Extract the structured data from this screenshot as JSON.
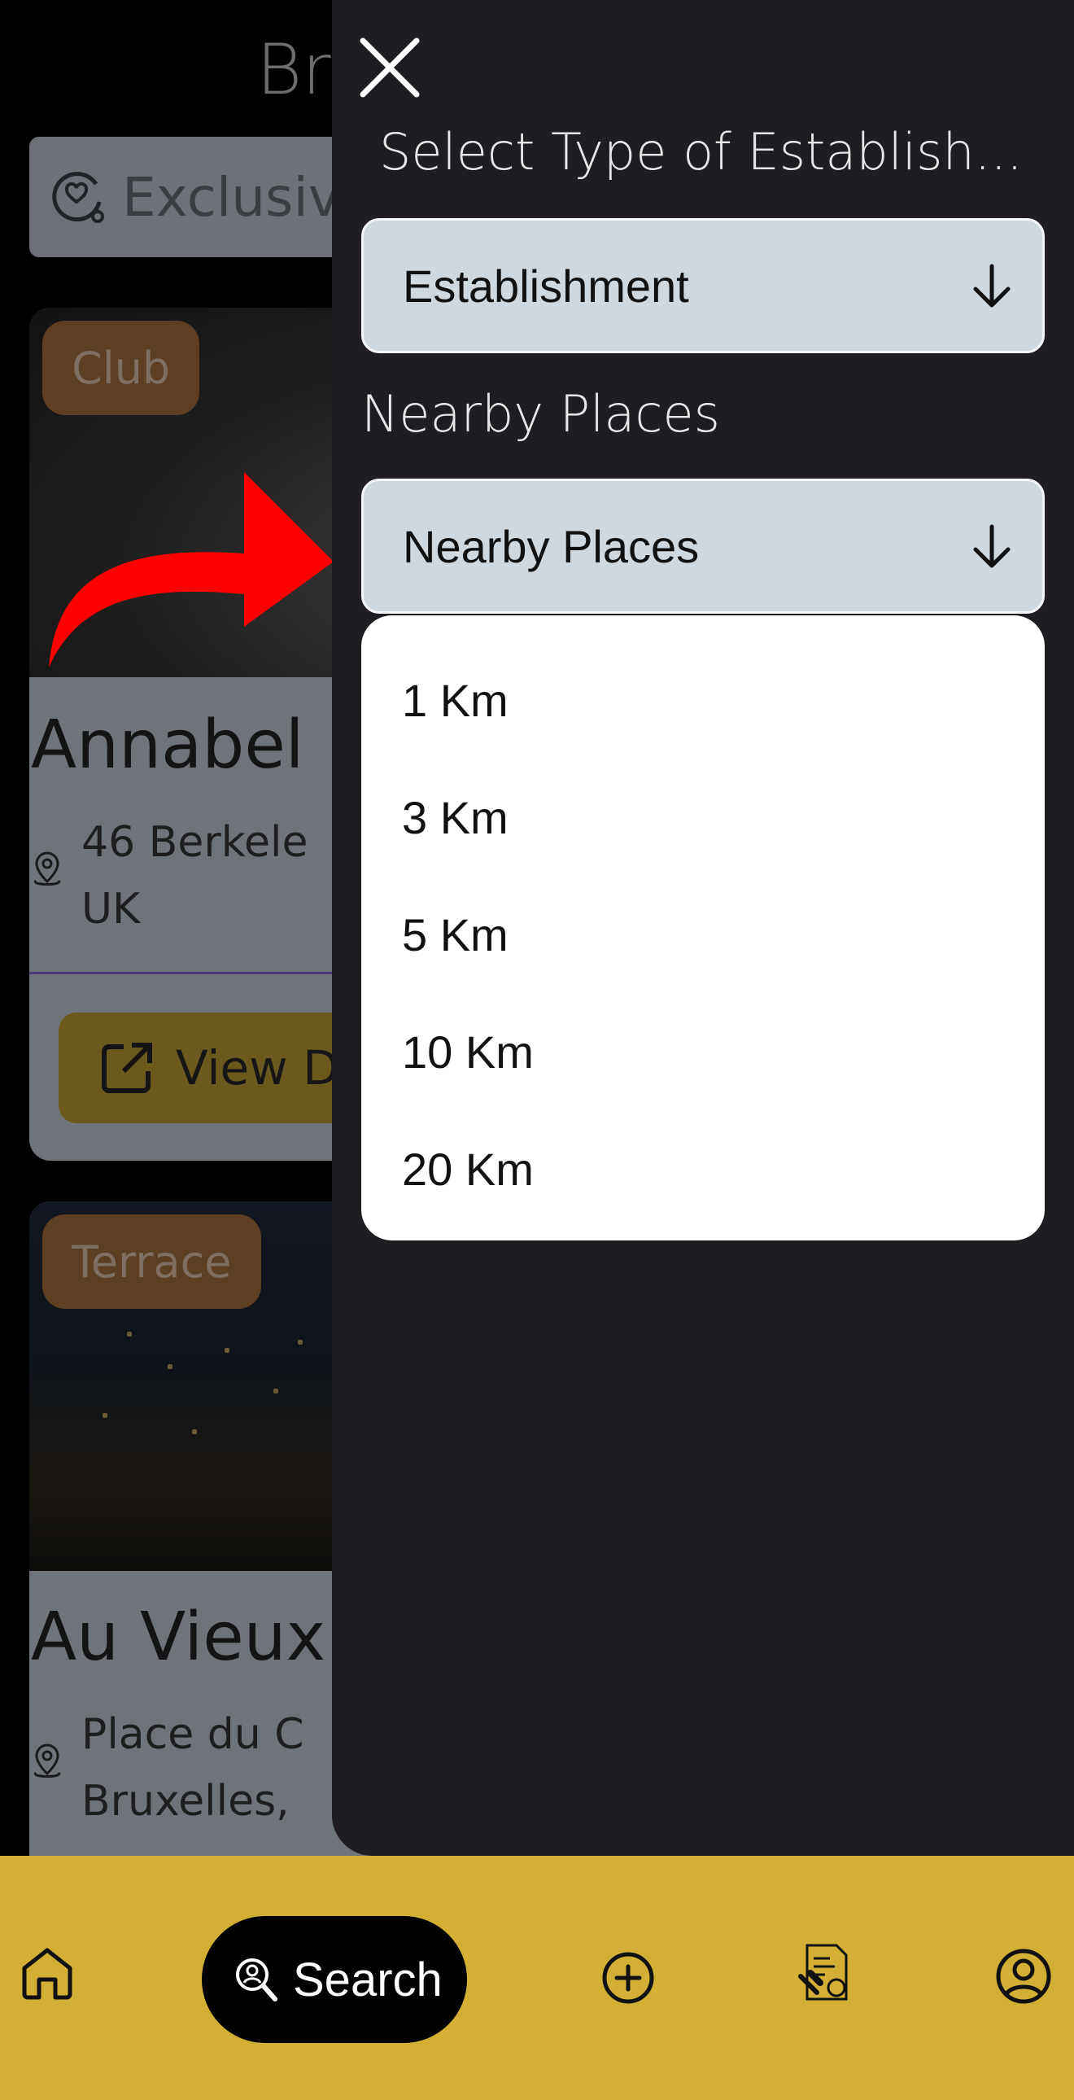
{
  "background": {
    "title": "Br",
    "exclusive_label": "Exclusiv",
    "cards": [
      {
        "badge": "Club",
        "name": "Annabel",
        "address": "46 Berkele\nUK",
        "button": "View D"
      },
      {
        "badge": "Terrace",
        "name": "Au Vieux",
        "address": "Place du C\nBruxelles,"
      }
    ]
  },
  "drawer": {
    "type_label": "Select Type of Establish...",
    "type_select": "Establishment",
    "nearby_label": "Nearby Places",
    "nearby_select": "Nearby Places",
    "options": [
      "1 Km",
      "3 Km",
      "5 Km",
      "10 Km",
      "20 Km"
    ]
  },
  "bottom_nav": {
    "search_label": "Search",
    "icons": [
      "home-icon",
      "search-person-icon",
      "plus-circle-icon",
      "document-gavel-icon",
      "profile-icon"
    ]
  },
  "colors": {
    "drawer_bg": "#1f1d22",
    "select_bg": "#ced8de",
    "nav_bg": "#d4af36",
    "annotation": "#ff0000"
  }
}
